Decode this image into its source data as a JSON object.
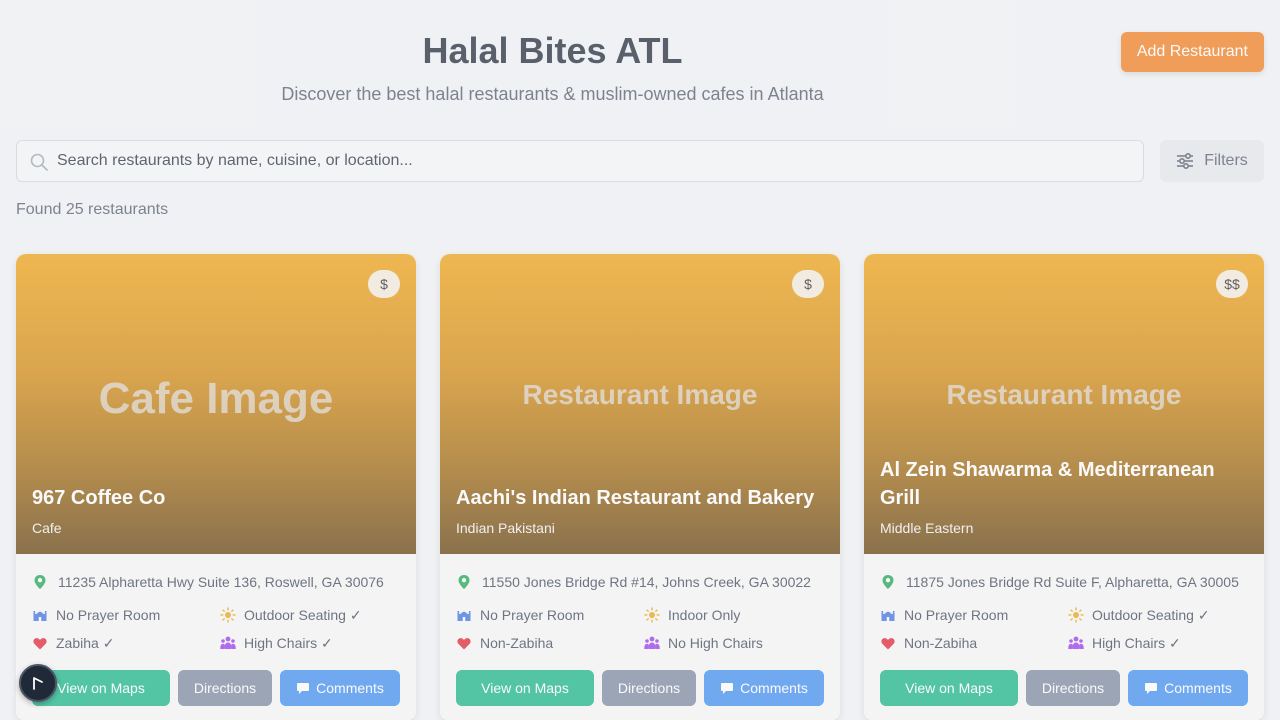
{
  "header": {
    "title": "Halal Bites ATL",
    "subtitle": "Discover the best halal restaurants & muslim-owned cafes in Atlanta",
    "add_button": "Add Restaurant"
  },
  "search": {
    "placeholder": "Search restaurants by name, cuisine, or location...",
    "filters_label": "Filters"
  },
  "results": {
    "found_text": "Found 25 restaurants"
  },
  "colors": {
    "accent": "#f07a16",
    "maps": "#10b485",
    "directions": "#78869c",
    "comments": "#3b8cf0"
  },
  "cards": [
    {
      "image_text": "Cafe Image",
      "price": "$",
      "name": "967 Coffee Co",
      "cuisine": "Cafe",
      "address": "11235 Alpharetta Hwy Suite 136, Roswell, GA 30076",
      "prayer": "No Prayer Room",
      "seating": "Outdoor Seating ✓",
      "zabiha": "Zabiha ✓",
      "chairs": "High Chairs ✓"
    },
    {
      "image_text": "Restaurant Image",
      "price": "$",
      "name": "Aachi's Indian Restaurant and Bakery",
      "cuisine": "Indian Pakistani",
      "address": "11550 Jones Bridge Rd #14, Johns Creek, GA 30022",
      "prayer": "No Prayer Room",
      "seating": "Indoor Only",
      "zabiha": "Non-Zabiha",
      "chairs": "No High Chairs"
    },
    {
      "image_text": "Restaurant Image",
      "price": "$$",
      "name": "Al Zein Shawarma & Mediterranean Grill",
      "cuisine": "Middle Eastern",
      "address": "11875 Jones Bridge Rd Suite F, Alpharetta, GA 30005",
      "prayer": "No Prayer Room",
      "seating": "Outdoor Seating ✓",
      "zabiha": "Non-Zabiha",
      "chairs": "High Chairs ✓"
    }
  ],
  "buttons": {
    "maps": "View on Maps",
    "directions": "Directions",
    "comments": "Comments"
  }
}
